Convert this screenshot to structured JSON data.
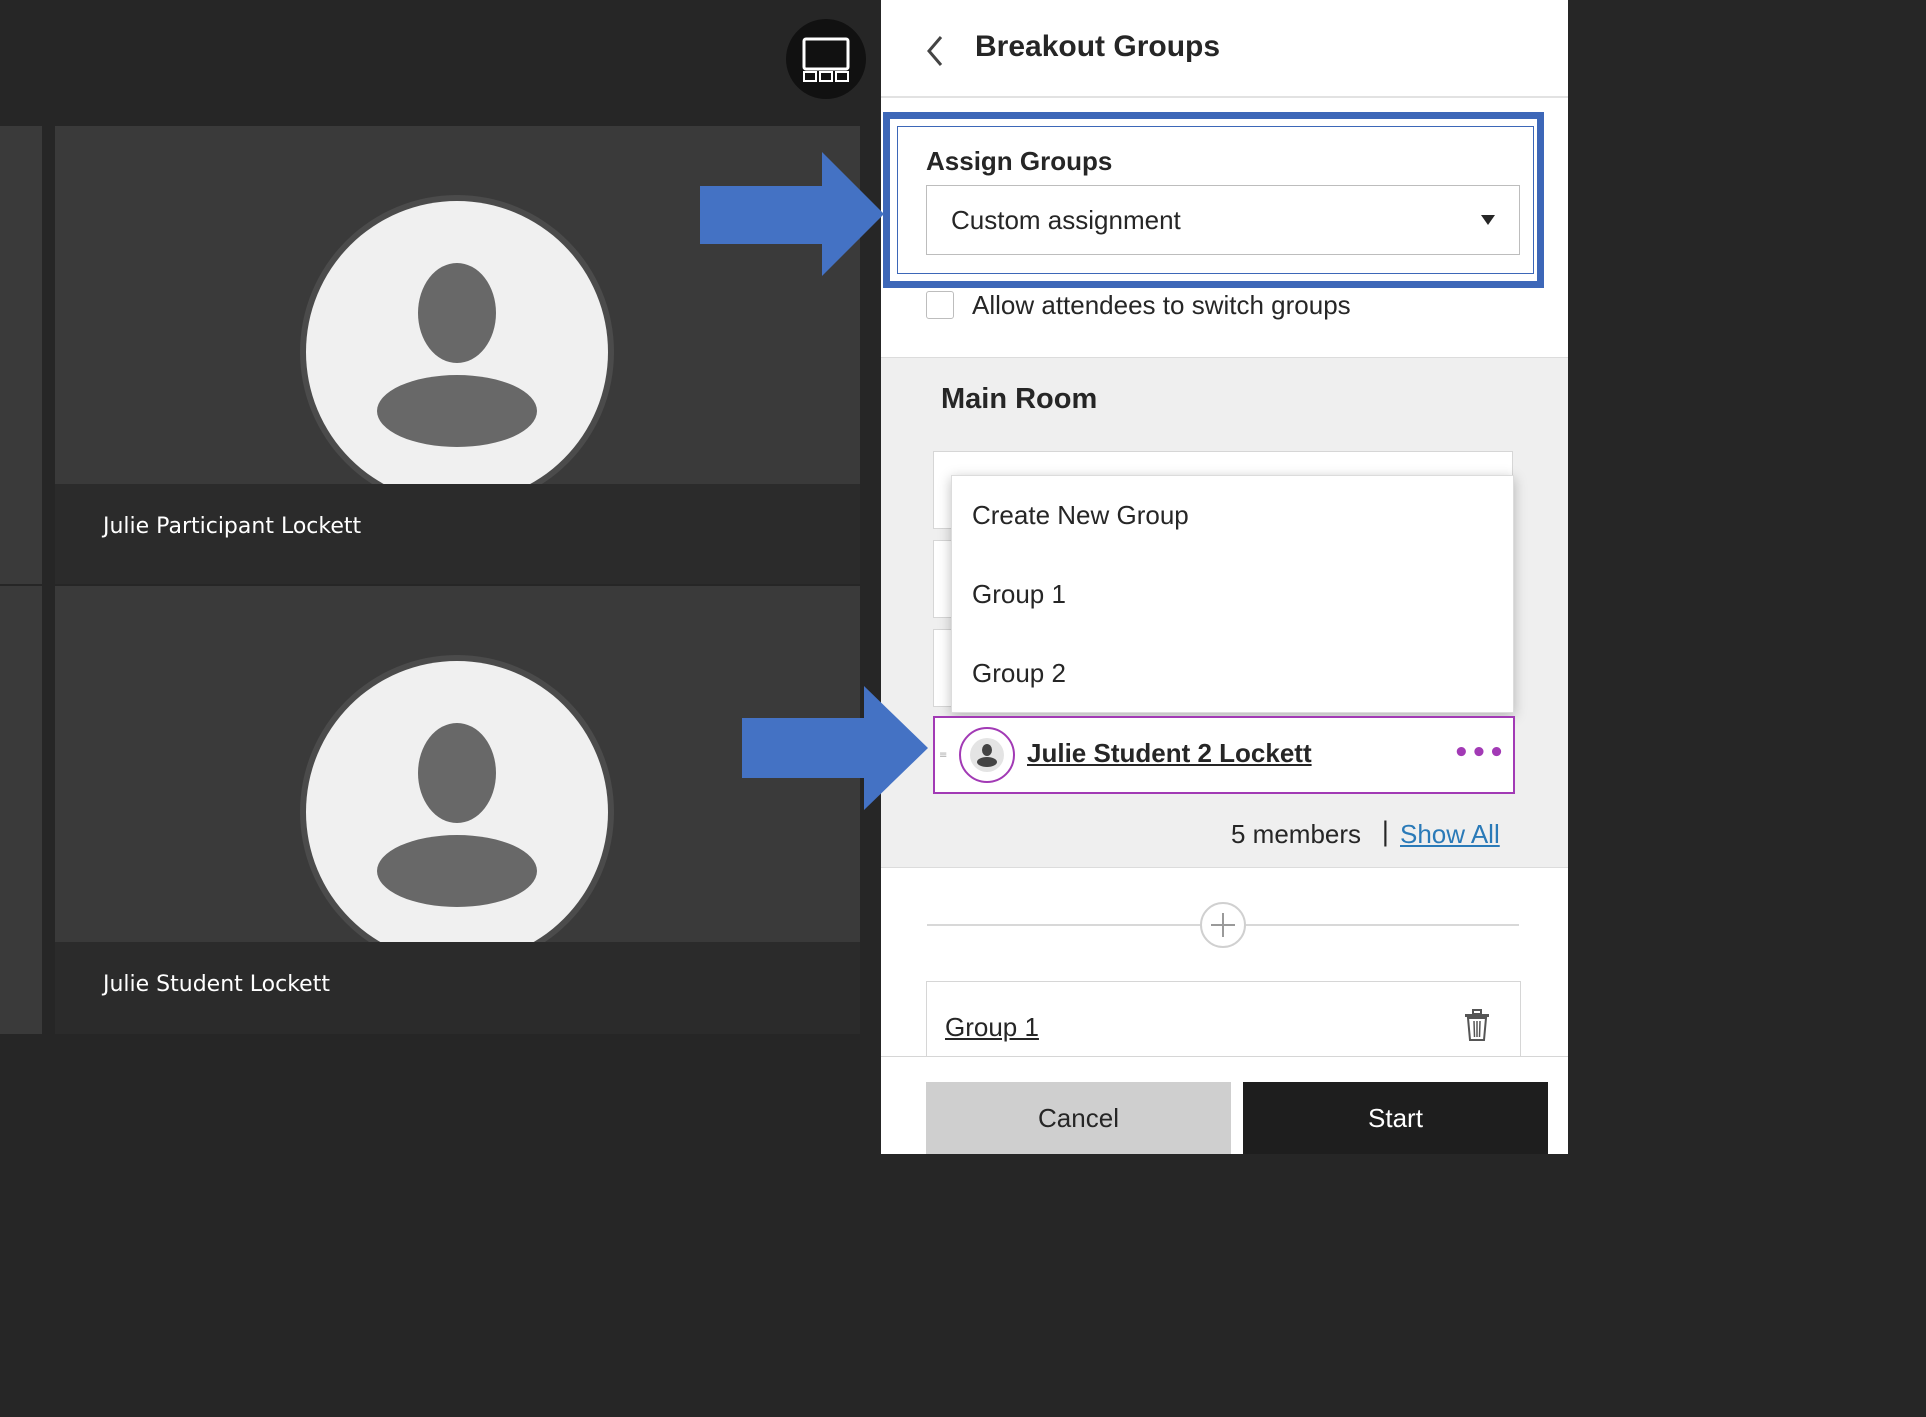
{
  "participants": [
    {
      "name": "Julie Participant Lockett"
    },
    {
      "name": "Julie Student Lockett"
    }
  ],
  "stage": {
    "layout_toggle_icon": "grid-layout-icon"
  },
  "panel": {
    "back_icon": "chevron-left-icon",
    "title": "Breakout Groups",
    "assign": {
      "label": "Assign Groups",
      "selected": "Custom assignment"
    },
    "allow_switch_label": "Allow attendees to switch groups",
    "main_room": {
      "title": "Main Room",
      "menu_items": [
        "Create New Group",
        "Group 1",
        "Group 2"
      ],
      "highlighted_member": "Julie Student 2 Lockett",
      "members_count": "5 members",
      "separator": "|",
      "show_all": "Show All"
    },
    "groups": [
      {
        "name": "Group 1"
      }
    ],
    "footer": {
      "cancel": "Cancel",
      "start": "Start"
    }
  },
  "annotation_colors": {
    "highlight_box": "#3d67b8",
    "arrow": "#4472c4",
    "menu_focus": "#a23ab5"
  }
}
